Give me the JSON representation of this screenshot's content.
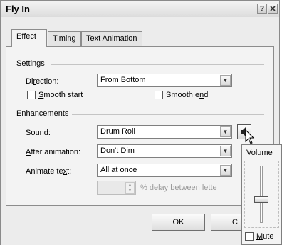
{
  "dialog": {
    "title": "Fly In",
    "help_button": "?",
    "close_button": "✕"
  },
  "tabs": [
    {
      "label": "Effect",
      "active": true
    },
    {
      "label": "Timing",
      "active": false
    },
    {
      "label": "Text Animation",
      "active": false
    }
  ],
  "settings": {
    "group_label": "Settings",
    "direction": {
      "label_pre": "Di",
      "label_u": "r",
      "label_post": "ection:",
      "value": "From Bottom"
    },
    "smooth_start": {
      "label_u": "S",
      "label_post": "mooth start",
      "checked": false
    },
    "smooth_end": {
      "label_pre": "Smooth e",
      "label_u": "n",
      "label_post": "d",
      "checked": false
    }
  },
  "enhancements": {
    "group_label": "Enhancements",
    "sound": {
      "label_u": "S",
      "label_post": "ound:",
      "value": "Drum Roll"
    },
    "after_animation": {
      "label_u": "A",
      "label_post": "fter animation:",
      "value": "Don't Dim"
    },
    "animate_text": {
      "label_pre": "Animate te",
      "label_u": "x",
      "label_post": "t:",
      "value": "All at once"
    },
    "delay": {
      "value": "",
      "suffix_pre": "% ",
      "suffix_u": "d",
      "suffix_post": "elay between lette"
    }
  },
  "buttons": {
    "ok": "OK",
    "cancel": "C"
  },
  "volume_popup": {
    "title_u": "V",
    "title_post": "olume",
    "level": 0.4,
    "mute_label_u": "M",
    "mute_label_post": "ute",
    "mute_checked": false
  },
  "icons": {
    "speaker": "speaker-icon",
    "cursor": "mouse-cursor-icon"
  }
}
